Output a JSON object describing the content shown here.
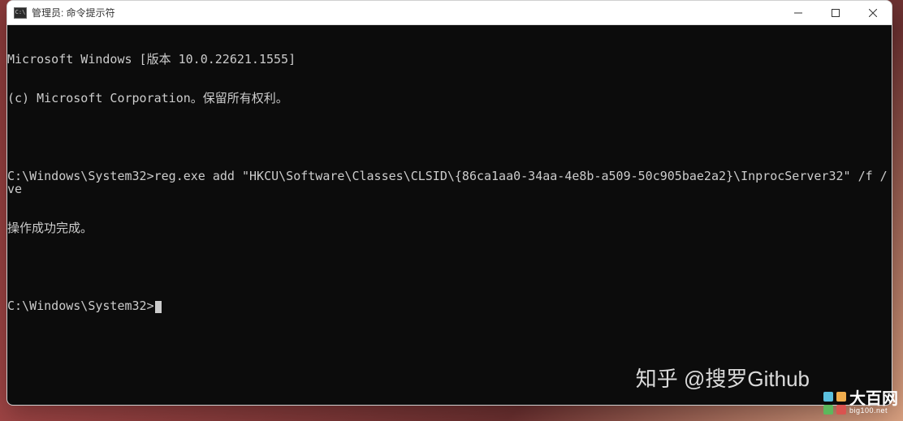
{
  "window": {
    "title": "管理员: 命令提示符",
    "icon_text": "C:\\"
  },
  "terminal": {
    "lines": [
      "Microsoft Windows [版本 10.0.22621.1555]",
      "(c) Microsoft Corporation。保留所有权利。",
      "",
      "C:\\Windows\\System32>reg.exe add \"HKCU\\Software\\Classes\\CLSID\\{86ca1aa0-34aa-4e8b-a509-50c905bae2a2}\\InprocServer32\" /f /ve",
      "操作成功完成。",
      "",
      "C:\\Windows\\System32>"
    ]
  },
  "watermarks": {
    "zhihu": "知乎 @搜罗Github",
    "big100_cn": "大百网",
    "big100_en": "big100.net"
  }
}
